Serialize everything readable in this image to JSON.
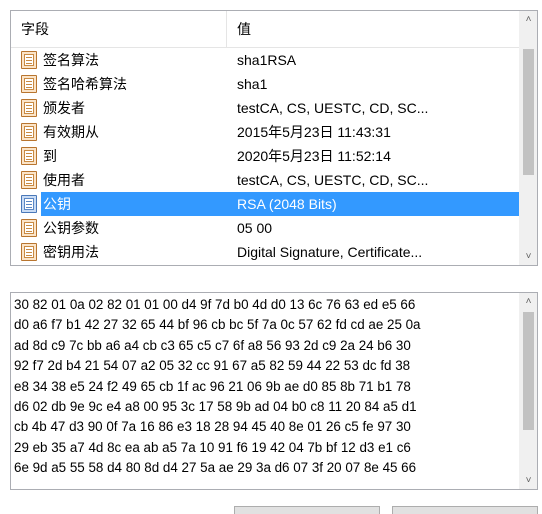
{
  "table": {
    "header_field": "字段",
    "header_value": "值",
    "rows": [
      {
        "field": "签名算法",
        "value": "sha1RSA",
        "icon": "certificate-doc-icon",
        "selected": false
      },
      {
        "field": "签名哈希算法",
        "value": "sha1",
        "icon": "certificate-doc-icon",
        "selected": false
      },
      {
        "field": "颁发者",
        "value": "testCA, CS, UESTC, CD, SC...",
        "icon": "certificate-doc-icon",
        "selected": false
      },
      {
        "field": "有效期从",
        "value": "2015年5月23日 11:43:31",
        "icon": "certificate-doc-icon",
        "selected": false
      },
      {
        "field": "到",
        "value": "2020年5月23日 11:52:14",
        "icon": "certificate-doc-icon",
        "selected": false
      },
      {
        "field": "使用者",
        "value": "testCA, CS, UESTC, CD, SC...",
        "icon": "certificate-doc-icon",
        "selected": false
      },
      {
        "field": "公钥",
        "value": "RSA (2048 Bits)",
        "icon": "certificate-doc-icon",
        "selected": true
      },
      {
        "field": "公钥参数",
        "value": "05 00",
        "icon": "certificate-doc-icon",
        "selected": false
      },
      {
        "field": "密钥用法",
        "value": "Digital Signature, Certificate...",
        "icon": "certificate-doc-icon",
        "selected": false
      }
    ]
  },
  "hex": {
    "lines": [
      "30 82 01 0a 02 82 01 01 00 d4 9f 7d b0 4d d0 13 6c 76 63 ed e5 66",
      "d0 a6 f7 b1 42 27 32 65 44 bf 96 cb bc 5f 7a 0c 57 62 fd cd ae 25 0a",
      "ad 8d c9 7c bb a6 a4 cb c3 65 c5 c7 6f a8 56 93 2d c9 2a 24 b6 30",
      "92 f7 2d b4 21 54 07 a2 05 32 cc 91 67 a5 82 59 44 22 53 dc fd 38",
      "e8 34 38 e5 24 f2 49 65 cb 1f ac 96 21 06 9b ae d0 85 8b 71 b1 78",
      "d6 02 db 9e 9c e4 a8 00 95 3c 17 58 9b ad 04 b0 c8 11 20 84 a5 d1",
      "cb 4b 47 d3 90 0f 7a 16 86 e3 18 28 94 45 40 8e 01 26 c5 fe 97 30",
      "29 eb 35 a7 4d 8c ea ab a5 7a 10 91 f6 19 42 04 7b bf 12 d3 e1 c6",
      "6e 9d a5 55 58 d4 80 8d d4 27 5a ae 29 3a d6 07 3f 20 07 8e 45 66"
    ]
  },
  "scroll": {
    "up_glyph": "˄",
    "down_glyph": "˅"
  },
  "colors": {
    "selection": "#3399ff",
    "border": "#abadb3",
    "scrollbar_track": "#f0f0f0",
    "scrollbar_thumb": "#c2c2c2"
  }
}
